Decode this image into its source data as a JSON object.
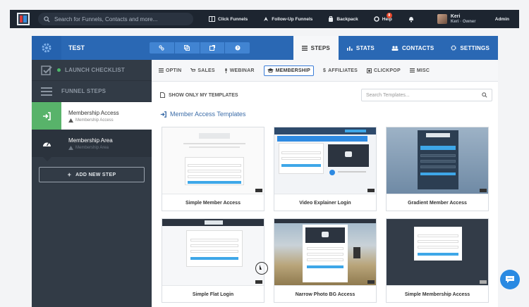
{
  "topbar": {
    "search_placeholder": "Search for Funnels, Contacts and more...",
    "nav": [
      "Click Funnels",
      "Follow-Up Funnels",
      "Backpack",
      "Help"
    ],
    "help_badge": "8",
    "user_name": "Keri",
    "user_role": "Keri · Owner",
    "admin": "Admin"
  },
  "funnel": {
    "title": "TEST",
    "tabs": [
      "STEPS",
      "STATS",
      "CONTACTS",
      "SETTINGS"
    ]
  },
  "sidebar": {
    "launch": "LAUNCH CHECKLIST",
    "funnel_steps": "FUNNEL STEPS",
    "steps": [
      {
        "name": "Membership Access",
        "sub": "Membership Access"
      },
      {
        "name": "Membership Area",
        "sub": "Membership Area"
      }
    ],
    "add_step": "ADD NEW STEP"
  },
  "categories": [
    "OPTIN",
    "SALES",
    "WEBINAR",
    "MEMBERSHIP",
    "AFFILIATES",
    "CLICKPOP",
    "MISC"
  ],
  "filter": {
    "only_mine": "SHOW ONLY MY TEMPLATES",
    "search_placeholder": "Search Templates..."
  },
  "section_title": "Member Access Templates",
  "templates": [
    {
      "name": "Simple Member Access"
    },
    {
      "name": "Video Explainer Login"
    },
    {
      "name": "Gradient Member Access"
    },
    {
      "name": "Simple Flat Login"
    },
    {
      "name": "Narrow Photo BG Access"
    },
    {
      "name": "Simple Membership Access"
    }
  ],
  "colors": {
    "header_blue": "#2a68b4",
    "sidebar_dark": "#323b46",
    "step_green": "#58b36a",
    "chat_blue": "#2a8ae2"
  }
}
